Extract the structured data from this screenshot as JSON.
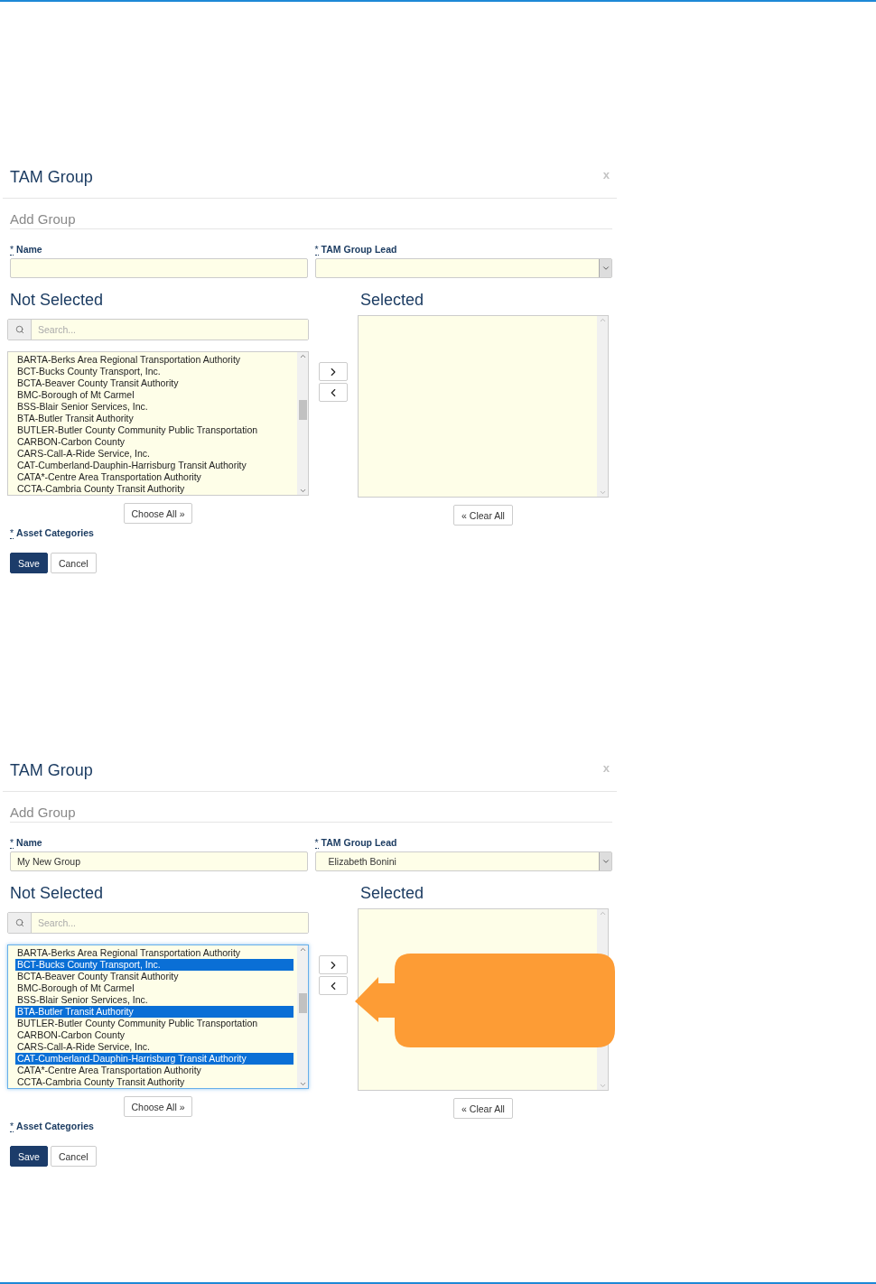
{
  "panels": [
    {
      "title": "TAM Group",
      "close": "x",
      "subtitle": "Add Group",
      "name_field": {
        "required_mark": "*",
        "label": "Name"
      },
      "lead_field": {
        "required_mark": "*",
        "label": "TAM Group Lead"
      },
      "not_selected": {
        "heading": "Not Selected",
        "search_placeholder": "Search...",
        "focused": false,
        "items": [
          {
            "label": "BARTA-Berks Area Regional Transportation Authority",
            "selected": false
          },
          {
            "label": "BCT-Bucks County Transport, Inc.",
            "selected": false
          },
          {
            "label": "BCTA-Beaver County Transit Authority",
            "selected": false
          },
          {
            "label": "BMC-Borough of Mt Carmel",
            "selected": false
          },
          {
            "label": "BSS-Blair Senior Services, Inc.",
            "selected": false
          },
          {
            "label": "BTA-Butler Transit Authority",
            "selected": false
          },
          {
            "label": "BUTLER-Butler County Community Public Transportation",
            "selected": false
          },
          {
            "label": "CARBON-Carbon County",
            "selected": false
          },
          {
            "label": "CARS-Call-A-Ride Service, Inc.",
            "selected": false
          },
          {
            "label": "CAT-Cumberland-Dauphin-Harrisburg Transit Authority",
            "selected": false
          },
          {
            "label": "CATA*-Centre Area Transportation Authority",
            "selected": false
          },
          {
            "label": "CCTA-Cambria County Transit Authority",
            "selected": false
          }
        ],
        "button": "Choose All »"
      },
      "selected": {
        "heading": "Selected",
        "button": "« Clear All"
      },
      "asset_categories": {
        "required_mark": "*",
        "label": "Asset Categories"
      },
      "buttons": [
        "Save",
        "Cancel"
      ]
    },
    {
      "title": "TAM Group",
      "close": "x",
      "subtitle": "Add Group",
      "callout": true,
      "name_field": {
        "required_mark": "*",
        "label": "Name",
        "value": "My New Group"
      },
      "lead_field": {
        "required_mark": "*",
        "label": "TAM Group Lead",
        "value": "Elizabeth Bonini"
      },
      "not_selected": {
        "heading": "Not Selected",
        "search_placeholder": "Search...",
        "focused": true,
        "items": [
          {
            "label": "BARTA-Berks Area Regional Transportation Authority",
            "selected": false
          },
          {
            "label": "BCT-Bucks County Transport, Inc.",
            "selected": true
          },
          {
            "label": "BCTA-Beaver County Transit Authority",
            "selected": false
          },
          {
            "label": "BMC-Borough of Mt Carmel",
            "selected": false
          },
          {
            "label": "BSS-Blair Senior Services, Inc.",
            "selected": false
          },
          {
            "label": "BTA-Butler Transit Authority",
            "selected": true
          },
          {
            "label": "BUTLER-Butler County Community Public Transportation",
            "selected": false
          },
          {
            "label": "CARBON-Carbon County",
            "selected": false
          },
          {
            "label": "CARS-Call-A-Ride Service, Inc.",
            "selected": false
          },
          {
            "label": "CAT-Cumberland-Dauphin-Harrisburg Transit Authority",
            "selected": true
          },
          {
            "label": "CATA*-Centre Area Transportation Authority",
            "selected": false
          },
          {
            "label": "CCTA-Cambria County Transit Authority",
            "selected": false
          }
        ],
        "button": "Choose All »"
      },
      "selected": {
        "heading": "Selected",
        "button": "« Clear All"
      },
      "asset_categories": {
        "required_mark": "*",
        "label": "Asset Categories"
      },
      "buttons": [
        "Save",
        "Cancel"
      ]
    }
  ]
}
